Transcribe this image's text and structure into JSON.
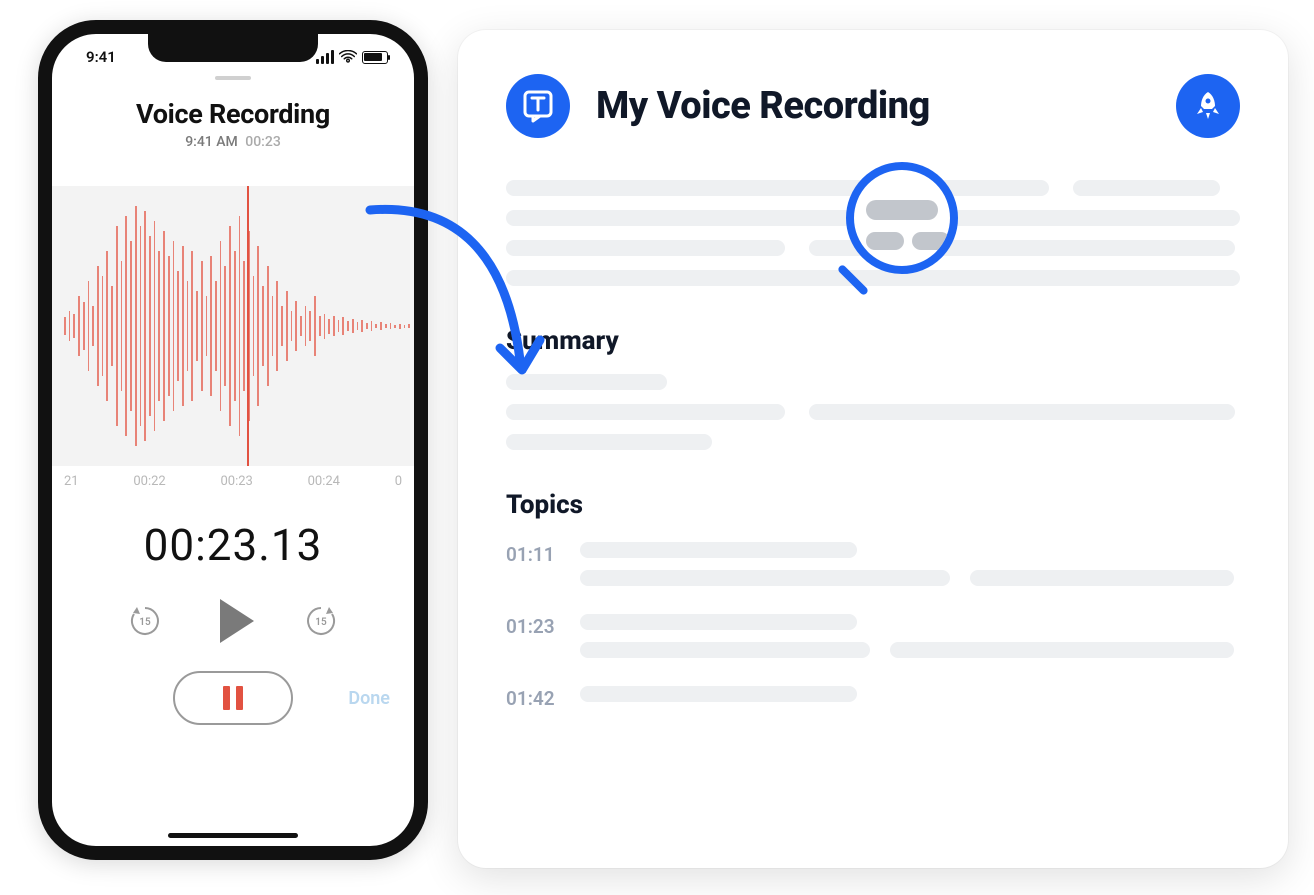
{
  "phone": {
    "status_time": "9:41",
    "title": "Voice Recording",
    "subtitle_time": "9:41 AM",
    "subtitle_duration": "00:23",
    "ticks": [
      "21",
      "00:22",
      "00:23",
      "00:24",
      "0"
    ],
    "big_timer": "00:23.13",
    "skip_amount": "15",
    "done_label": "Done"
  },
  "card": {
    "title": "My Voice Recording",
    "summary_heading": "Summary",
    "topics_heading": "Topics",
    "topics": [
      {
        "time": "01:11"
      },
      {
        "time": "01:23"
      },
      {
        "time": "01:42"
      }
    ]
  },
  "colors": {
    "accent": "#1d64f2",
    "wave": "#e25241"
  }
}
